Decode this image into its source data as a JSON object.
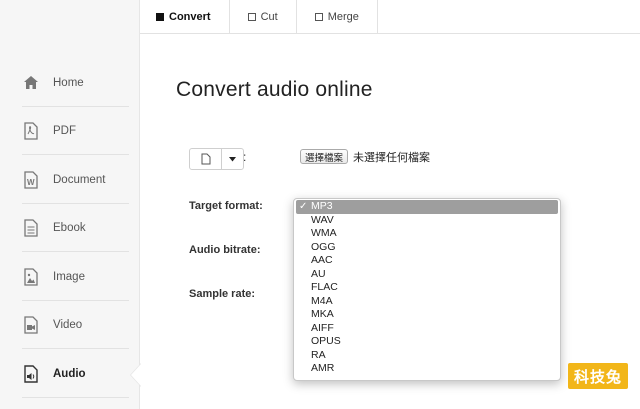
{
  "sidebar": {
    "items": [
      {
        "label": "Home",
        "icon": "home-icon"
      },
      {
        "label": "PDF",
        "icon": "pdf-icon"
      },
      {
        "label": "Document",
        "icon": "document-icon"
      },
      {
        "label": "Ebook",
        "icon": "ebook-icon"
      },
      {
        "label": "Image",
        "icon": "image-icon"
      },
      {
        "label": "Video",
        "icon": "video-icon"
      },
      {
        "label": "Audio",
        "icon": "audio-icon",
        "active": true
      }
    ]
  },
  "tabs": [
    {
      "label": "Convert",
      "active": true
    },
    {
      "label": "Cut"
    },
    {
      "label": "Merge"
    }
  ],
  "main": {
    "title": "Convert audio online",
    "file": {
      "colon": ":",
      "choose_label": "選擇檔案",
      "no_file_text": "未選擇任何檔案"
    },
    "fields": {
      "target_format": "Target format:",
      "audio_bitrate": "Audio bitrate:",
      "sample_rate": "Sample rate:"
    },
    "format_dropdown": {
      "selected": "MP3",
      "check": "✓",
      "options": [
        "MP3",
        "WAV",
        "WMA",
        "OGG",
        "AAC",
        "AU",
        "FLAC",
        "M4A",
        "MKA",
        "AIFF",
        "OPUS",
        "RA",
        "AMR"
      ]
    }
  },
  "watermark": "科技兔",
  "colors": {
    "accent": "#f2b619",
    "selected_option": "#9e9e9e",
    "sidebar_bg": "#f6f6f6"
  }
}
